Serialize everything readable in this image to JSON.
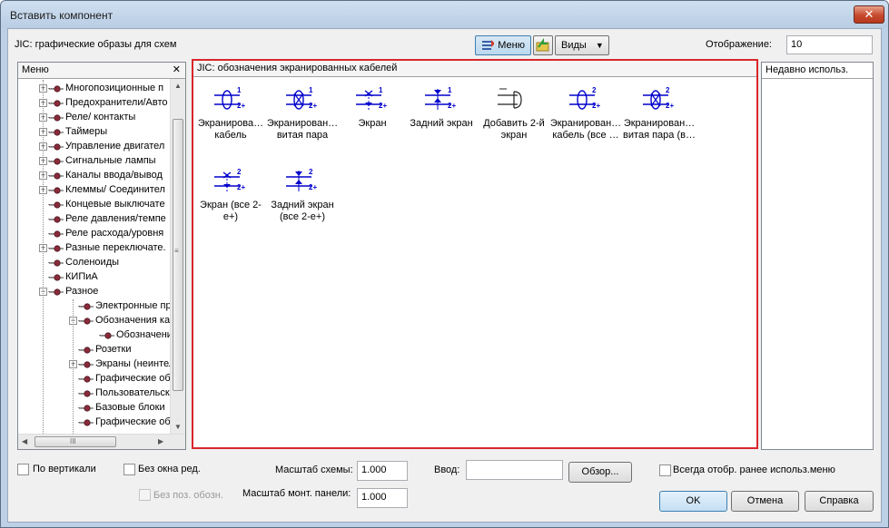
{
  "window": {
    "title": "Вставить компонент",
    "close_glyph": "✕"
  },
  "header": {
    "subtitle": "JIC: графические образы для схем",
    "menu_button": "Меню",
    "views_button": "Виды",
    "display_label": "Отображение:",
    "display_value": "10"
  },
  "menu_panel": {
    "title": "Меню",
    "close_glyph": "✕",
    "tree": [
      {
        "label": "Многопозиционные п",
        "level": 0,
        "expander": "+"
      },
      {
        "label": "Предохранители/Авто",
        "level": 0,
        "expander": "+"
      },
      {
        "label": "Реле/ контакты",
        "level": 0,
        "expander": "+"
      },
      {
        "label": "Таймеры",
        "level": 0,
        "expander": "+"
      },
      {
        "label": "Управление двигател",
        "level": 0,
        "expander": "+"
      },
      {
        "label": "Сигнальные лампы",
        "level": 0,
        "expander": "+"
      },
      {
        "label": "Каналы ввода/вывод",
        "level": 0,
        "expander": "+"
      },
      {
        "label": "Клеммы/ Соединител",
        "level": 0,
        "expander": "+"
      },
      {
        "label": "Концевые выключате",
        "level": 0,
        "expander": ""
      },
      {
        "label": "Реле давления/темпе",
        "level": 0,
        "expander": ""
      },
      {
        "label": "Реле расхода/уровня",
        "level": 0,
        "expander": ""
      },
      {
        "label": "Разные переключате.",
        "level": 0,
        "expander": "+"
      },
      {
        "label": "Соленоиды",
        "level": 0,
        "expander": ""
      },
      {
        "label": "КИПиА",
        "level": 0,
        "expander": ""
      },
      {
        "label": "Разное",
        "level": 0,
        "expander": "−"
      },
      {
        "label": "Электронные при",
        "level": 1,
        "expander": ""
      },
      {
        "label": "Обозначения кабе",
        "level": 1,
        "expander": "−"
      },
      {
        "label": "Обозначения",
        "level": 2,
        "expander": ""
      },
      {
        "label": "Розетки",
        "level": 1,
        "expander": ""
      },
      {
        "label": "Экраны (неинтелл",
        "level": 1,
        "expander": "+"
      },
      {
        "label": "Графические обра",
        "level": 1,
        "expander": ""
      },
      {
        "label": "Пользовательски",
        "level": 1,
        "expander": ""
      },
      {
        "label": "Базовые блоки",
        "level": 1,
        "expander": ""
      },
      {
        "label": "Графические обра",
        "level": 1,
        "expander": ""
      }
    ],
    "hscroll_grip": "III",
    "vscroll_grip": "≡"
  },
  "icons_panel": {
    "title": "JIC: обозначения экранированных кабелей",
    "items": [
      {
        "label": "Экранирова… кабель",
        "icon": "shielded-cable-icon",
        "n1": "1",
        "n2": "2+"
      },
      {
        "label": "Экранирован… витая пара",
        "icon": "shielded-twisted-pair-icon",
        "n1": "1",
        "n2": "2+"
      },
      {
        "label": "Экран",
        "icon": "shield-icon",
        "n1": "1",
        "n2": "2+"
      },
      {
        "label": "Задний экран",
        "icon": "back-shield-icon",
        "n1": "1",
        "n2": "2+"
      },
      {
        "label": "Добавить 2-й экран",
        "icon": "add-second-shield-icon",
        "n1": "",
        "n2": ""
      },
      {
        "label": "Экранирован… кабель (все …",
        "icon": "shielded-cable-all-icon",
        "n1": "2",
        "n2": "2+"
      },
      {
        "label": "Экранирован… витая пара (в…",
        "icon": "shielded-twisted-pair-all-icon",
        "n1": "2",
        "n2": "2+"
      },
      {
        "label": "Экран (все 2-е+)",
        "icon": "shield-all-icon",
        "n1": "2",
        "n2": "2+"
      },
      {
        "label": "Задний экран (все 2-е+)",
        "icon": "back-shield-all-icon",
        "n1": "2",
        "n2": "2+"
      }
    ],
    "accent_color": "#0000cc",
    "highlight_color": "#d9262b"
  },
  "recent_panel": {
    "title": "Недавно использ."
  },
  "footer": {
    "vertical_label": "По вертикали",
    "no_edit_window_label": "Без окна ред.",
    "no_pos_label": "Без поз. обозн.",
    "scheme_scale_label": "Масштаб схемы:",
    "scheme_scale_value": "1.000",
    "panel_scale_label": "Масштаб монт. панели:",
    "panel_scale_value": "1.000",
    "input_label": "Ввод:",
    "input_value": "",
    "browse_button": "Обзор...",
    "always_show_label": "Всегда отобр. ранее использ.меню",
    "ok_button": "OK",
    "cancel_button": "Отмена",
    "help_button": "Справка"
  }
}
